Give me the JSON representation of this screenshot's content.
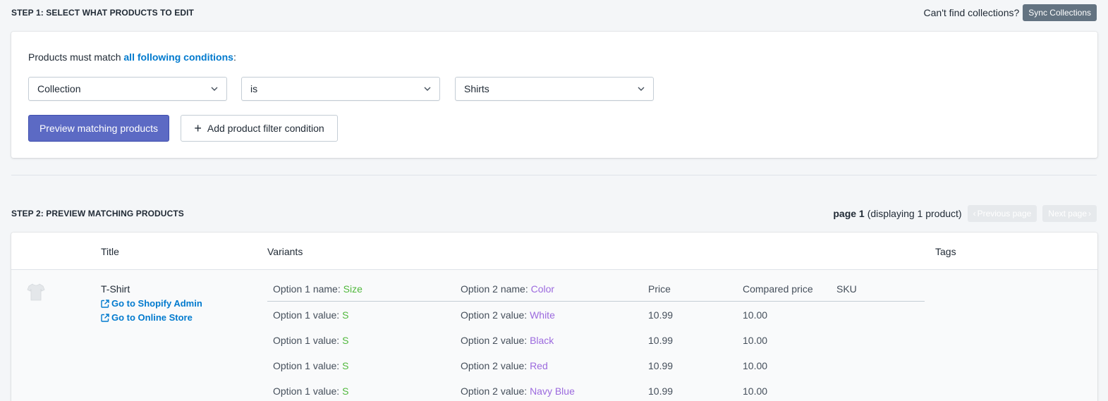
{
  "step1": {
    "title": "STEP 1: SELECT WHAT PRODUCTS TO EDIT",
    "cant_find": "Can't find collections?",
    "sync_label": "Sync Collections",
    "condition_prefix": "Products must match ",
    "condition_accent": "all following conditions",
    "condition_suffix": ":",
    "filters": {
      "field": "Collection",
      "operator": "is",
      "value": "Shirts"
    },
    "preview_label": "Preview matching products",
    "add_filter_label": "Add product filter condition"
  },
  "step2": {
    "title": "STEP 2: PREVIEW MATCHING PRODUCTS",
    "page_label": "page 1",
    "display_text": "(displaying 1 product)",
    "prev_label": "Previous page",
    "next_label": "Next page",
    "columns": {
      "title": "Title",
      "variants": "Variants",
      "tags": "Tags"
    },
    "product": {
      "title": "T-Shirt",
      "admin_link": "Go to Shopify Admin",
      "store_link": "Go to Online Store",
      "variant_header": {
        "opt1_label": "Option 1 name: ",
        "opt1_name": "Size",
        "opt2_label": "Option 2 name: ",
        "opt2_name": "Color",
        "price": "Price",
        "compared": "Compared price",
        "sku": "SKU"
      },
      "variants": [
        {
          "opt1_label": "Option 1 value: ",
          "opt1": "S",
          "opt2_label": "Option 2 value: ",
          "opt2": "White",
          "price": "10.99",
          "compared": "10.00"
        },
        {
          "opt1_label": "Option 1 value: ",
          "opt1": "S",
          "opt2_label": "Option 2 value: ",
          "opt2": "Black",
          "price": "10.99",
          "compared": "10.00"
        },
        {
          "opt1_label": "Option 1 value: ",
          "opt1": "S",
          "opt2_label": "Option 2 value: ",
          "opt2": "Red",
          "price": "10.99",
          "compared": "10.00"
        },
        {
          "opt1_label": "Option 1 value: ",
          "opt1": "S",
          "opt2_label": "Option 2 value: ",
          "opt2": "Navy Blue",
          "price": "10.99",
          "compared": "10.00"
        }
      ]
    }
  },
  "colors": {
    "primary": "#5c6ac4",
    "link": "#007ace",
    "option1_value": "#50b83c",
    "option2_value": "#9c6ade"
  }
}
